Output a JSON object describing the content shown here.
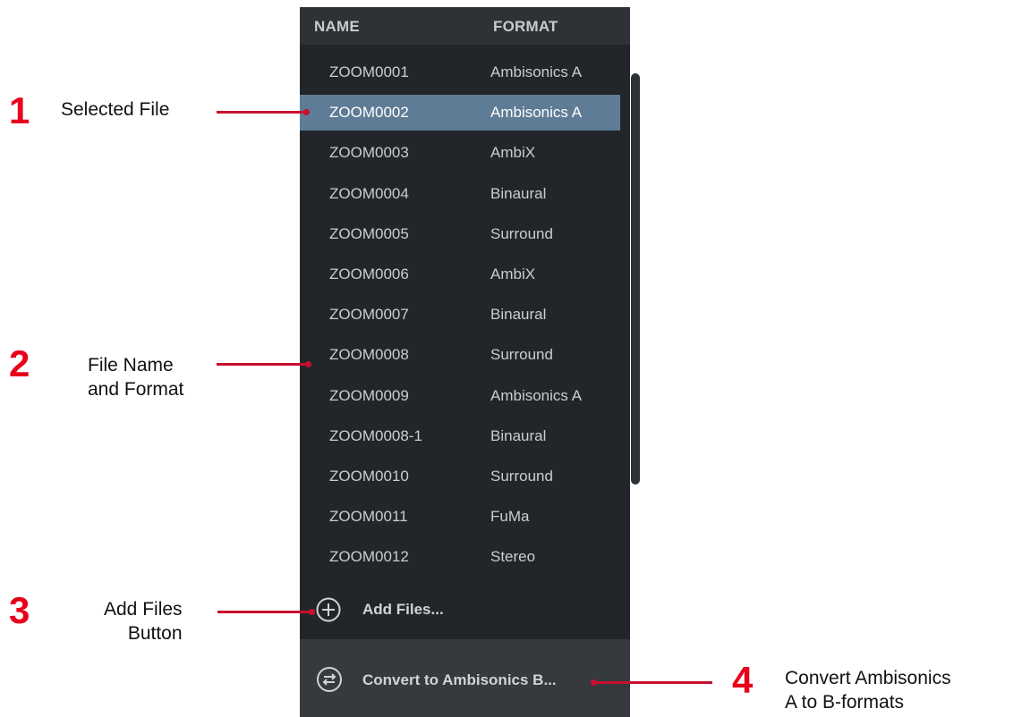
{
  "panel": {
    "columns": {
      "name": "NAME",
      "format": "FORMAT"
    },
    "files": [
      {
        "name": "ZOOM0001",
        "format": "Ambisonics A",
        "selected": false
      },
      {
        "name": "ZOOM0002",
        "format": "Ambisonics A",
        "selected": true
      },
      {
        "name": "ZOOM0003",
        "format": "AmbiX",
        "selected": false
      },
      {
        "name": "ZOOM0004",
        "format": "Binaural",
        "selected": false
      },
      {
        "name": "ZOOM0005",
        "format": "Surround",
        "selected": false
      },
      {
        "name": "ZOOM0006",
        "format": "AmbiX",
        "selected": false
      },
      {
        "name": "ZOOM0007",
        "format": "Binaural",
        "selected": false
      },
      {
        "name": "ZOOM0008",
        "format": "Surround",
        "selected": false
      },
      {
        "name": "ZOOM0009",
        "format": "Ambisonics A",
        "selected": false
      },
      {
        "name": "ZOOM0008-1",
        "format": "Binaural",
        "selected": false
      },
      {
        "name": "ZOOM0010",
        "format": "Surround",
        "selected": false
      },
      {
        "name": "ZOOM0011",
        "format": "FuMa",
        "selected": false
      },
      {
        "name": "ZOOM0012",
        "format": "Stereo",
        "selected": false
      }
    ],
    "add_files": {
      "label": "Add Files...",
      "icon": "plus-circle-icon"
    },
    "convert": {
      "label": "Convert to Ambisonics B...",
      "icon": "convert-arrows-icon"
    }
  },
  "callouts": [
    {
      "number": "1",
      "text": "Selected File"
    },
    {
      "number": "2",
      "text": "File Name\nand Format"
    },
    {
      "number": "3",
      "text": "Add Files\nButton"
    },
    {
      "number": "4",
      "text": "Convert Ambisonics\nA to B-formats"
    }
  ],
  "colors": {
    "panel_bg": "#22262b",
    "header_bg": "#2e3236",
    "selected_row": "#5e7c95",
    "convert_bar": "#363a3e",
    "callout_red": "#e8001c"
  }
}
